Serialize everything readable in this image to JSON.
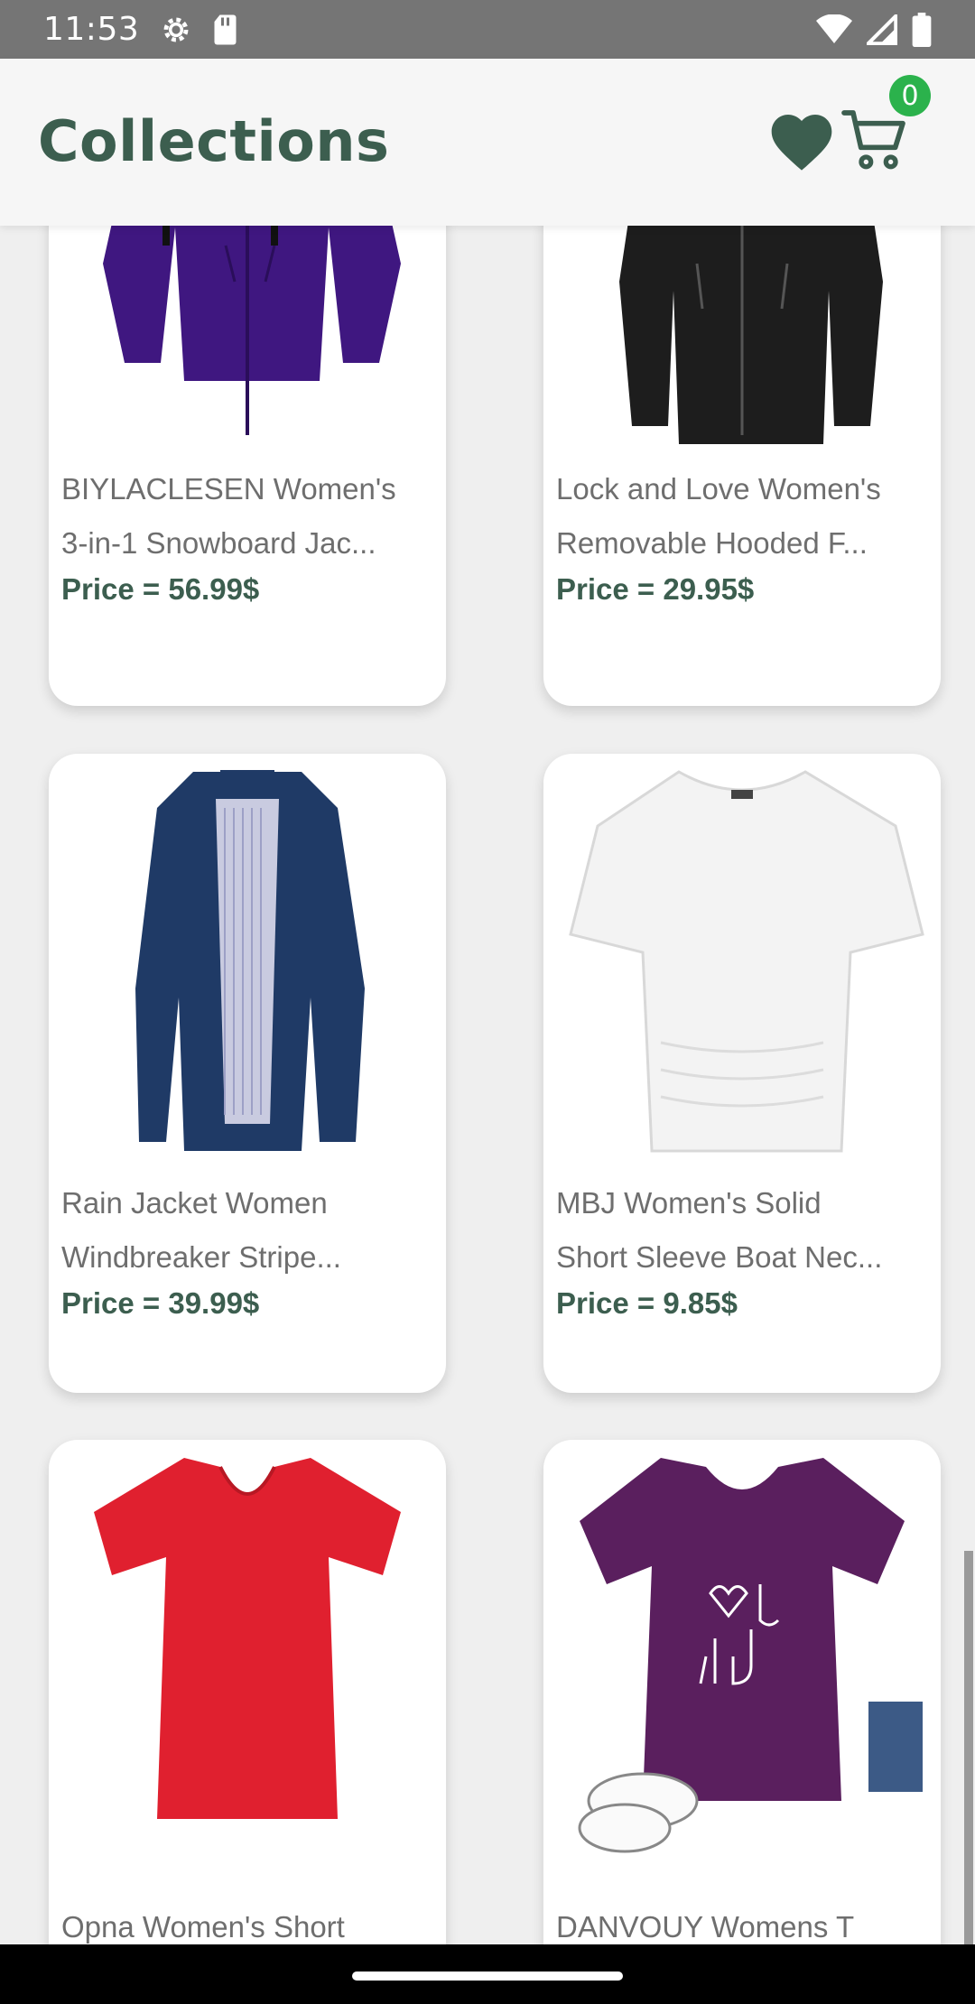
{
  "status_bar": {
    "time": "11:53",
    "icons": [
      "gear-icon",
      "sim-card-icon",
      "wifi-icon",
      "signal-icon",
      "battery-icon"
    ]
  },
  "app_bar": {
    "title": "Collections",
    "favorites_icon": "heart-icon",
    "cart_icon": "cart-icon",
    "cart_count": "0"
  },
  "colors": {
    "accent": "#3c5e4f",
    "badge": "#2bb24c",
    "status_bar": "#757575",
    "background": "#efefef"
  },
  "products": [
    {
      "line1": "BIYLACLESEN Women's",
      "line2": "3-in-1 Snowboard Jac...",
      "price": "Price = 56.99$",
      "image": "purple-jacket"
    },
    {
      "line1": "Lock and Love Women's",
      "line2": "Removable Hooded F...",
      "price": "Price = 29.95$",
      "image": "black-leather-jacket"
    },
    {
      "line1": "Rain Jacket Women",
      "line2": "Windbreaker Stripe...",
      "price": "Price = 39.99$",
      "image": "navy-rain-jacket"
    },
    {
      "line1": "MBJ Women's Solid",
      "line2": "Short Sleeve Boat Nec...",
      "price": "Price = 9.85$",
      "image": "white-top"
    },
    {
      "line1": "Opna Women's Short",
      "line2": "",
      "price": "",
      "image": "red-tshirt"
    },
    {
      "line1": "DANVOUY Womens T",
      "line2": "",
      "price": "",
      "image": "purple-be-kind-tshirt"
    }
  ]
}
